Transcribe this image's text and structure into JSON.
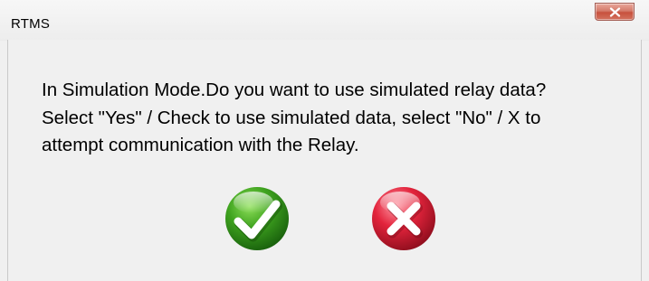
{
  "window": {
    "title": "RTMS",
    "close_label": "X"
  },
  "message": {
    "lines": [
      "In Simulation Mode.Do you want to use simulated relay data?",
      "Select \"Yes\" / Check to use simulated data, select \"No\" / X to",
      "attempt communication with the Relay."
    ]
  },
  "buttons": {
    "yes": {
      "icon": "green-check-icon",
      "color": "#2e8b1f"
    },
    "no": {
      "icon": "red-x-icon",
      "color": "#d8223a"
    }
  }
}
